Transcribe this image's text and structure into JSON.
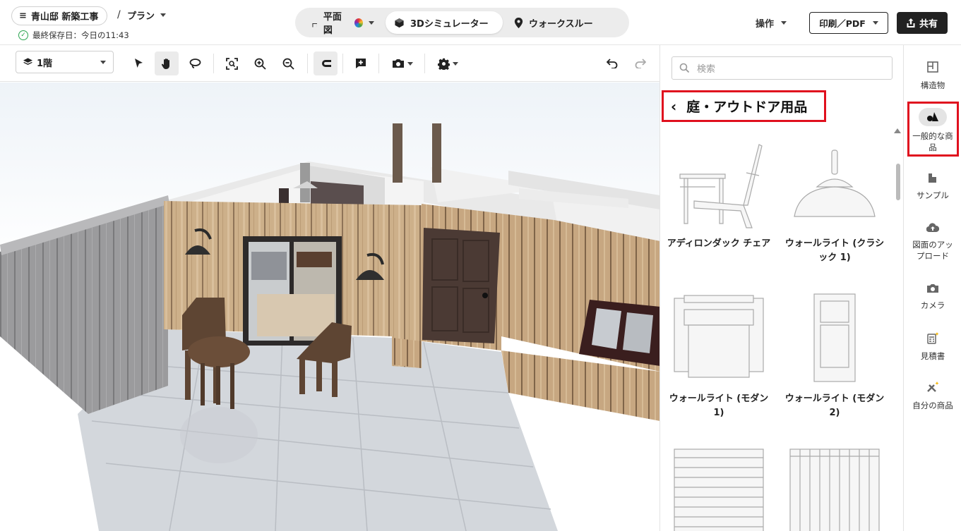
{
  "project": {
    "name": "青山邸 新築工事",
    "separator": "/",
    "plan": "プラン",
    "saved": "最終保存日：今日の11:43"
  },
  "modes": [
    {
      "label": "平面図",
      "icon": "floorplan-icon",
      "active": false
    },
    {
      "label": "3Dシミュレーター",
      "icon": "cube-icon",
      "active": true
    },
    {
      "label": "ウォークスルー",
      "icon": "location-pin-icon",
      "active": false
    }
  ],
  "header": {
    "ops_label": "操作",
    "print_label": "印刷／PDF",
    "share_label": "共有"
  },
  "toolbar": {
    "floor": "1階"
  },
  "catalog": {
    "search_placeholder": "検索",
    "category": "庭・アウトドア用品",
    "items": [
      {
        "label": "アディロンダック チェア"
      },
      {
        "label": "ウォールライト (クラシック 1)"
      },
      {
        "label": "ウォールライト (モダン 1)"
      },
      {
        "label": "ウォールライト (モダン 2)"
      }
    ]
  },
  "rail": [
    {
      "label": "構造物",
      "icon": "structure-icon"
    },
    {
      "label": "一般的な商品",
      "icon": "product-icon",
      "active": true
    },
    {
      "label": "サンプル",
      "icon": "sample-icon"
    },
    {
      "label": "図面のアップロード",
      "icon": "upload-icon"
    },
    {
      "label": "カメラ",
      "icon": "camera-icon"
    },
    {
      "label": "見積書",
      "icon": "estimate-icon"
    },
    {
      "label": "自分の商品",
      "icon": "my-products-icon"
    }
  ],
  "colors": {
    "highlight": "#e0101e",
    "saved_ok": "#2aa44f",
    "share_bg": "#222222"
  }
}
